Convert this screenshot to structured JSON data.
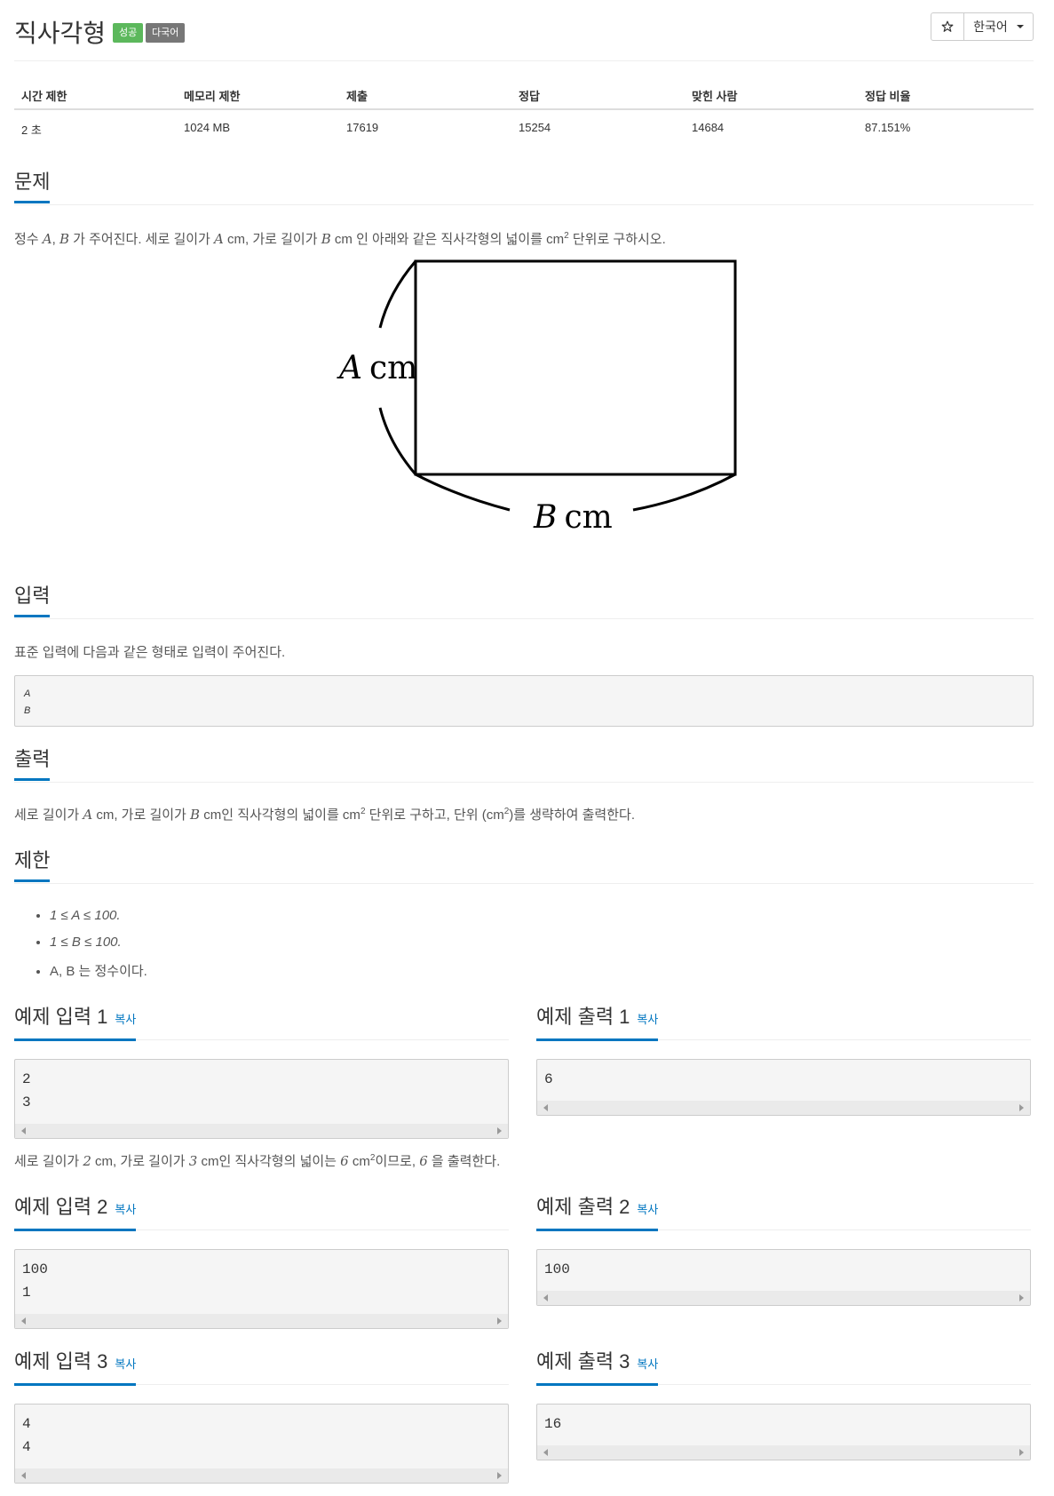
{
  "header": {
    "title": "직사각형",
    "badge_success": "성공",
    "badge_multilang": "다국어",
    "star_icon": "star-outline",
    "language": "한국어"
  },
  "info": {
    "headers": [
      "시간 제한",
      "메모리 제한",
      "제출",
      "정답",
      "맞힌 사람",
      "정답 비율"
    ],
    "values": [
      "2 초",
      "1024 MB",
      "17619",
      "15254",
      "14684",
      "87.151%"
    ]
  },
  "problem": {
    "heading": "문제",
    "text_a": "정수 ",
    "var_a": "A",
    "comma": ", ",
    "var_b": "B",
    "text_b": " 가 주어진다. 세로 길이가 ",
    "text_c": " cm, 가로 길이가 ",
    "text_d": " cm 인 아래와 같은 직사각형의 넓이를 cm",
    "sup2": "2",
    "text_e": " 단위로 구하시오.",
    "fig_label_a": "A",
    "fig_label_b": "B",
    "fig_unit": "cm"
  },
  "input": {
    "heading": "입력",
    "text": "표준 입력에 다음과 같은 형태로 입력이 주어진다.",
    "format_lines": [
      "A",
      "B"
    ]
  },
  "output": {
    "heading": "출력",
    "text_a": "세로 길이가 ",
    "text_b": " cm, 가로 길이가 ",
    "text_c": " cm인 직사각형의 넓이를 cm",
    "text_d": " 단위로 구하고, 단위 (cm",
    "text_e": ")를 생략하여 출력한다."
  },
  "limits": {
    "heading": "제한",
    "items": [
      "1 ≤ A ≤ 100.",
      "1 ≤ B ≤ 100.",
      "A, B 는 정수이다."
    ]
  },
  "samples": {
    "copy_label": "복사",
    "in1_heading": "예제 입력 1",
    "out1_heading": "예제 출력 1",
    "in1": [
      "2",
      "3"
    ],
    "out1": [
      "6"
    ],
    "explain_a": "세로 길이가 ",
    "explain_v1": "2",
    "explain_b": " cm, 가로 길이가 ",
    "explain_v2": "3",
    "explain_c": " cm인 직사각형의 넓이는 ",
    "explain_v3": "6",
    "explain_d": " cm",
    "explain_e": "이므로, ",
    "explain_v4": "6",
    "explain_f": " 을 출력한다.",
    "in2_heading": "예제 입력 2",
    "out2_heading": "예제 출력 2",
    "in2": [
      "100",
      "1"
    ],
    "out2": [
      "100"
    ],
    "in3_heading": "예제 입력 3",
    "out3_heading": "예제 출력 3",
    "in3": [
      "4",
      "4"
    ],
    "out3": [
      "16"
    ]
  },
  "colors": {
    "accent": "#0076c0",
    "success": "#5cb85c",
    "badge_gray": "#777777"
  }
}
